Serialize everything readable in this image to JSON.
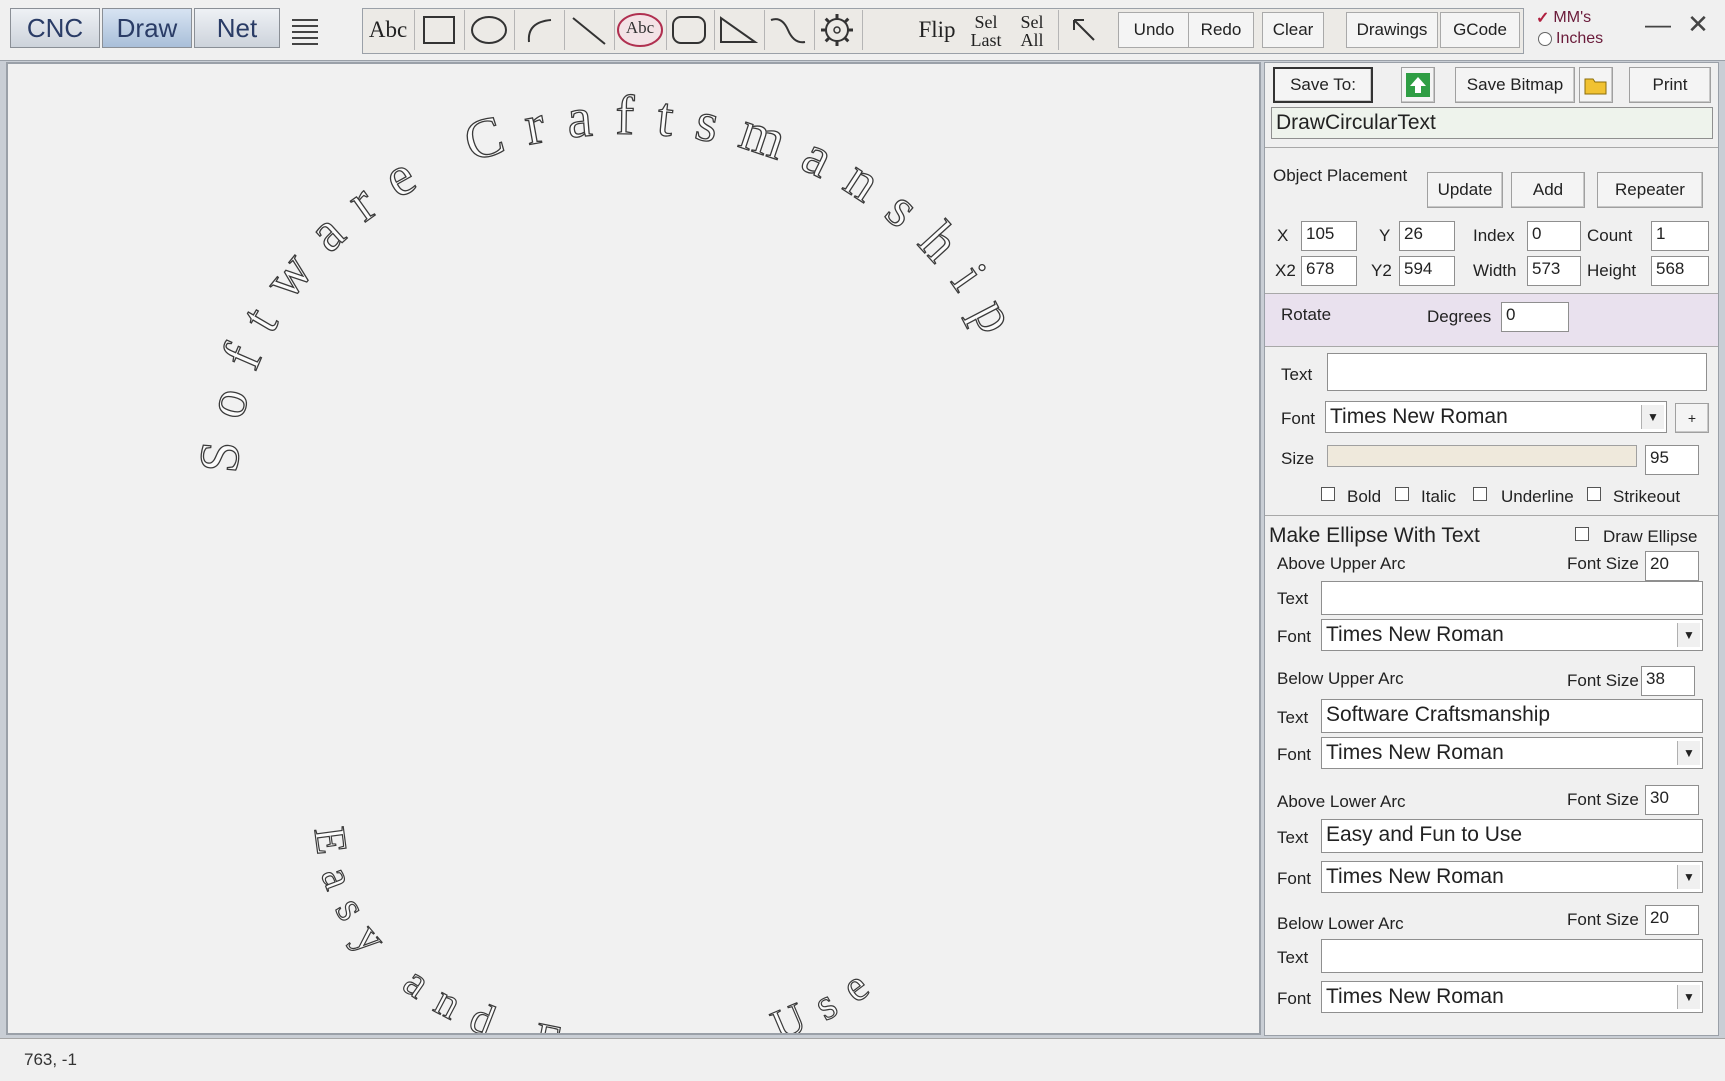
{
  "window": {
    "mode_tabs": [
      "CNC",
      "Draw",
      "Net"
    ],
    "active_tab": "Draw"
  },
  "toolbar": {
    "text_tool_label": "Abc",
    "circular_text_tool_label": "Abc",
    "flip_label": "Flip",
    "sel_last": [
      "Sel",
      "Last"
    ],
    "sel_all": [
      "Sel",
      "All"
    ],
    "undo_label": "Undo",
    "redo_label": "Redo",
    "clear_label": "Clear",
    "drawings_label": "Drawings",
    "gcode_label": "GCode",
    "units": {
      "mm_label": "MM's",
      "inches_label": "Inches",
      "selected": "MM's"
    },
    "minimize_glyph": "—",
    "close_glyph": "✕"
  },
  "canvas": {
    "upper_arc_text": "Software Craftsmanship",
    "lower_arc_text": "Easy and Fun to Use"
  },
  "panel": {
    "save_to_label": "Save To:",
    "save_bitmap_label": "Save Bitmap",
    "print_label": "Print",
    "filename": "DrawCircularText",
    "object_placement": {
      "title": "Object Placement",
      "update_label": "Update",
      "add_label": "Add",
      "repeater_label": "Repeater",
      "x_label": "X",
      "x": "105",
      "y_label": "Y",
      "y": "26",
      "index_label": "Index",
      "index": "0",
      "count_label": "Count",
      "count": "1",
      "x2_label": "X2",
      "x2": "678",
      "y2_label": "Y2",
      "y2": "594",
      "width_label": "Width",
      "width": "573",
      "height_label": "Height",
      "height": "568"
    },
    "rotate": {
      "title": "Rotate",
      "degrees_label": "Degrees",
      "degrees": "0"
    },
    "text_props": {
      "text_label": "Text",
      "text": "",
      "font_label": "Font",
      "font": "Times New Roman",
      "plus_label": "+",
      "size_label": "Size",
      "size": "95",
      "bold_label": "Bold",
      "italic_label": "Italic",
      "underline_label": "Underline",
      "strikeout_label": "Strikeout"
    },
    "ellipse": {
      "title": "Make Ellipse With Text",
      "draw_ellipse_label": "Draw Ellipse",
      "font_size_label": "Font Size",
      "text_label": "Text",
      "font_label": "Font",
      "sections": [
        {
          "title": "Above Upper Arc",
          "font_size": "20",
          "text": "",
          "font": "Times New Roman"
        },
        {
          "title": "Below Upper Arc",
          "font_size": "38",
          "text": "Software Craftsmanship",
          "font": "Times New Roman"
        },
        {
          "title": "Above Lower Arc",
          "font_size": "30",
          "text": "Easy and Fun to Use",
          "font": "Times New Roman"
        },
        {
          "title": "Below Lower Arc",
          "font_size": "20",
          "text": "",
          "font": "Times New Roman"
        }
      ]
    }
  },
  "status": {
    "coords": "763, -1"
  }
}
